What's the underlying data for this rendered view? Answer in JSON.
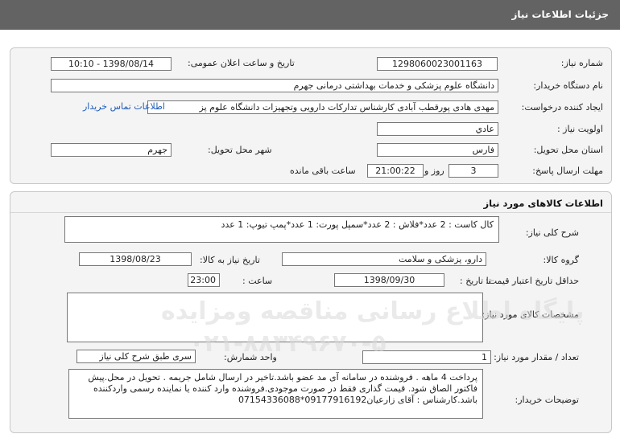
{
  "header": {
    "title": "جزئیات اطلاعات نیاز"
  },
  "need_info": {
    "need_number_label": "شماره نیاز:",
    "need_number": "1298060023001163",
    "announce_label": "تاریخ و ساعت اعلان عمومی:",
    "announce_value": "1398/08/14 - 10:10",
    "buyer_org_label": "نام دستگاه خریدار:",
    "buyer_org": "دانشگاه علوم پزشکی و خدمات بهداشتی درمانی جهرم",
    "creator_label": "ایجاد کننده درخواست:",
    "creator": "مهدی هادی پورقطب آبادی کارشناس تدارکات دارویی وتجهیزات دانشگاه علوم پز",
    "contact_link": "اطلاعات تماس خریدار",
    "priority_label": "اولویت نیاز :",
    "priority": "عادي",
    "province_label": "استان محل تحویل:",
    "province": "فارس",
    "city_label": "شهر محل تحویل:",
    "city": "جهرم",
    "deadline_label": "مهلت ارسال پاسخ:",
    "deadline_days": "3",
    "days_and_label": "روز و",
    "deadline_time": "21:00:22",
    "remaining_label": "ساعت باقی مانده"
  },
  "goods_info": {
    "section_title": "اطلاعات کالاهای مورد نیاز",
    "summary_label": "شرح کلی نیاز:",
    "summary": "کال کاست : 2 عدد*فلاش : 2 عدد*سمپل پورت: 1 عدد*پمپ تیوپ: 1 عدد",
    "group_label": "گروه کالا:",
    "group": "دارو، پزشکی و سلامت",
    "need_date_label": "تاریخ نیاز به کالا:",
    "need_date": "1398/08/23",
    "min_validity_label": "حداقل تاریخ اعتبار قیمت:",
    "until_date_label": "تا تاریخ :",
    "until_date": "1398/09/30",
    "hour_label": "ساعت :",
    "hour": "23:00",
    "specs_label": "مشخصات کالای مورد نیاز:",
    "specs": "",
    "qty_label": "تعداد / مقدار مورد نیاز:",
    "qty": "1",
    "unit_label": "واحد شمارش:",
    "unit": "سری طبق شرح کلی نیاز",
    "buyer_notes_label": "توضیحات خریدار:",
    "buyer_notes": "پرداخت 4 ماهه . فروشنده در سامانه آی مد عضو باشد.تاخیر در ارسال شامل جریمه  . تحویل در محل.پیش فاکتور الصاق شود. قیمت گذاری فقط در صورت موجودی.فروشنده وارد کننده یا نماینده رسمی واردکننده باشد.کارشناس : آقای زارعیان09177916192*07154336088"
  },
  "watermark": {
    "line1": "پایگاه اطلاع رسانی مناقصه ومزایده",
    "line2": "۰۲۱-۸۸۳۴۹۶۷۰-۵"
  }
}
